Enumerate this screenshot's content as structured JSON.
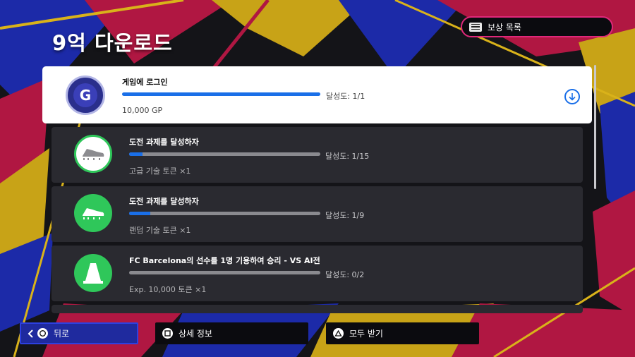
{
  "page": {
    "title": "9억 다운로드"
  },
  "header": {
    "rewards_label": "보상 목록"
  },
  "missions": [
    {
      "icon": "G",
      "name": "게임에 로그인",
      "progress": "달성도: 1/1",
      "progress_fraction": 1.0,
      "reward": "10,000 GP"
    },
    {
      "icon": "boot-icon",
      "name": "도전 과제를 달성하자",
      "progress": "달성도: 1/15",
      "progress_fraction": 0.067,
      "reward": "고급 기술 토큰 ×1"
    },
    {
      "icon": "boot-icon",
      "name": "도전 과제를 달성하자",
      "progress": "달성도: 1/9",
      "progress_fraction": 0.111,
      "reward": "랜덤 기술 토큰 ×1"
    },
    {
      "icon": "cone-icon",
      "name": "FC Barcelona의 선수를 1명 기용하여 승리 - VS AI전",
      "progress": "달성도: 0/2",
      "progress_fraction": 0.0,
      "reward": "Exp. 10,000 토큰 ×1"
    }
  ],
  "footer": {
    "back_label": "뒤로",
    "details_label": "상세 정보",
    "claim_all_label": "모두 받기"
  },
  "colors": {
    "accent_blue": "#1a6fe8",
    "badge_green": "#2fc75a",
    "rewards_border": "#e0287a",
    "selected_button": "#1f2a9e"
  }
}
